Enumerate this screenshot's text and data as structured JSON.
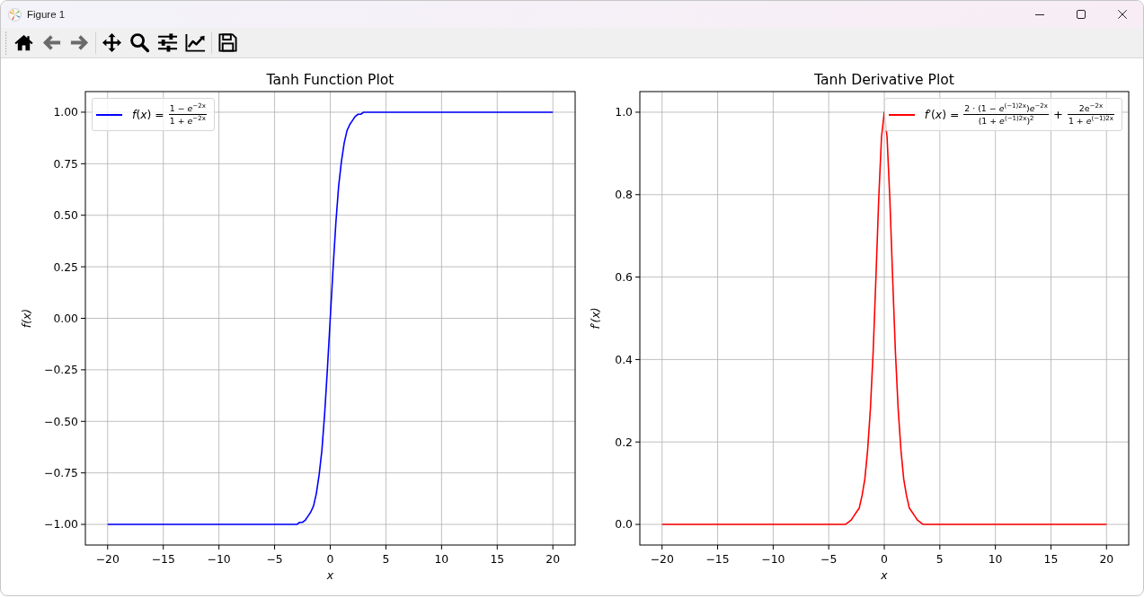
{
  "window": {
    "title": "Figure 1"
  },
  "toolbar": {
    "groups": [
      {
        "buttons": [
          {
            "kind": "home",
            "disabled": false
          },
          {
            "kind": "back",
            "disabled": true
          },
          {
            "kind": "forward",
            "disabled": true
          }
        ]
      },
      {
        "buttons": [
          {
            "kind": "pan",
            "disabled": false
          },
          {
            "kind": "zoom",
            "disabled": false
          },
          {
            "kind": "subplots",
            "disabled": false
          },
          {
            "kind": "customize",
            "disabled": false
          }
        ]
      },
      {
        "buttons": [
          {
            "kind": "save",
            "disabled": false
          }
        ]
      }
    ]
  },
  "panels": [
    {
      "chart_data": {
        "type": "line",
        "title": "Tanh Function Plot",
        "xlabel": "x",
        "ylabel": "f(x)",
        "x": [
          -20,
          -15,
          -10,
          -6,
          -5,
          -4,
          -3.5,
          -3,
          -2.75,
          -2.5,
          -2.25,
          -2,
          -1.75,
          -1.5,
          -1.25,
          -1,
          -0.75,
          -0.5,
          -0.25,
          0,
          0.25,
          0.5,
          0.75,
          1,
          1.25,
          1.5,
          1.75,
          2,
          2.25,
          2.5,
          2.75,
          3,
          3.5,
          4,
          5,
          6,
          10,
          15,
          20
        ],
        "series": [
          {
            "color": "#0000ff",
            "values": [
              -1,
              -1,
              -1,
              -1,
              -1,
              -1,
              -1,
              -1,
              -0.99,
              -0.99,
              -0.98,
              -0.96,
              -0.94,
              -0.91,
              -0.85,
              -0.76,
              -0.64,
              -0.46,
              -0.24,
              0,
              0.24,
              0.46,
              0.64,
              0.76,
              0.85,
              0.91,
              0.94,
              0.96,
              0.98,
              0.99,
              0.99,
              1,
              1,
              1,
              1,
              1,
              1,
              1,
              1
            ]
          }
        ],
        "xlim": [
          -22,
          22
        ],
        "ylim": [
          -1.1,
          1.1
        ],
        "xticks": [
          {
            "value": -20,
            "label": "−20"
          },
          {
            "value": -15,
            "label": "−15"
          },
          {
            "value": -10,
            "label": "−10"
          },
          {
            "value": -5,
            "label": "−5"
          },
          0,
          5,
          10,
          15,
          20
        ],
        "yticks": [
          {
            "value": -1,
            "label": "−1.00"
          },
          {
            "value": -0.75,
            "label": "−0.75"
          },
          {
            "value": -0.5,
            "label": "−0.50"
          },
          {
            "value": -0.25,
            "label": "−0.25"
          },
          {
            "value": 0,
            "label": "0.00"
          },
          {
            "value": 0.25,
            "label": "0.25"
          },
          {
            "value": 0.5,
            "label": "0.50"
          },
          {
            "value": 0.75,
            "label": "0.75"
          },
          {
            "value": 1,
            "label": "1.00"
          }
        ],
        "grid": true
      },
      "legend": {
        "entries": [
          {
            "label": "*f*(*x*) =",
            "expression": [
              {
                "kind": "fraction",
                "numerator": "1 − *e*$^{−2x}$",
                "denominator": "1 + *e*$^{−2x}$"
              }
            ]
          }
        ]
      }
    },
    {
      "chart_data": {
        "type": "line",
        "title": "Tanh Derivative Plot",
        "xlabel": "x",
        "ylabel": "f′(x)",
        "x": [
          -20,
          -15,
          -10,
          -6,
          -5,
          -4,
          -3.5,
          -3,
          -2.75,
          -2.5,
          -2.25,
          -2,
          -1.75,
          -1.5,
          -1.25,
          -1,
          -0.75,
          -0.5,
          -0.25,
          0,
          0.25,
          0.5,
          0.75,
          1,
          1.25,
          1.5,
          1.75,
          2,
          2.25,
          2.5,
          2.75,
          3,
          3.5,
          4,
          5,
          6,
          10,
          15,
          20
        ],
        "series": [
          {
            "color": "#ff0000",
            "values": [
              0,
              0,
              0,
              0,
              0,
              0,
              0,
              0.01,
              0.02,
              0.03,
              0.04,
              0.07,
              0.11,
              0.18,
              0.28,
              0.42,
              0.6,
              0.79,
              0.94,
              1,
              0.94,
              0.79,
              0.6,
              0.42,
              0.28,
              0.18,
              0.11,
              0.07,
              0.04,
              0.03,
              0.02,
              0.01,
              0,
              0,
              0,
              0,
              0,
              0,
              0
            ]
          }
        ],
        "xlim": [
          -22,
          22
        ],
        "ylim": [
          -0.05,
          1.05
        ],
        "xticks": [
          {
            "value": -20,
            "label": "−20"
          },
          {
            "value": -15,
            "label": "−15"
          },
          {
            "value": -10,
            "label": "−10"
          },
          {
            "value": -5,
            "label": "−5"
          },
          0,
          5,
          10,
          15,
          20
        ],
        "yticks": [
          {
            "value": 0,
            "label": "0.0"
          },
          {
            "value": 0.2,
            "label": "0.2"
          },
          {
            "value": 0.4,
            "label": "0.4"
          },
          {
            "value": 0.6,
            "label": "0.6"
          },
          {
            "value": 0.8,
            "label": "0.8"
          },
          {
            "value": 1,
            "label": "1.0"
          }
        ],
        "grid": true
      },
      "legend": {
        "entries": [
          {
            "label": "*f*′(*x*) =",
            "expression": [
              {
                "kind": "fraction",
                "numerator": "2 · (1 − *e*$^{(−1)2x}$)*e*$^{−2x}$",
                "denominator": "(1 + *e*$^{(−1)2x}$)$^{2}$"
              },
              {
                "kind": "operator",
                "text": "+"
              },
              {
                "kind": "fraction",
                "numerator": "2e$^{−2x}$",
                "denominator": "1 + *e*$^{(−1)2x}$"
              }
            ]
          }
        ]
      }
    }
  ]
}
